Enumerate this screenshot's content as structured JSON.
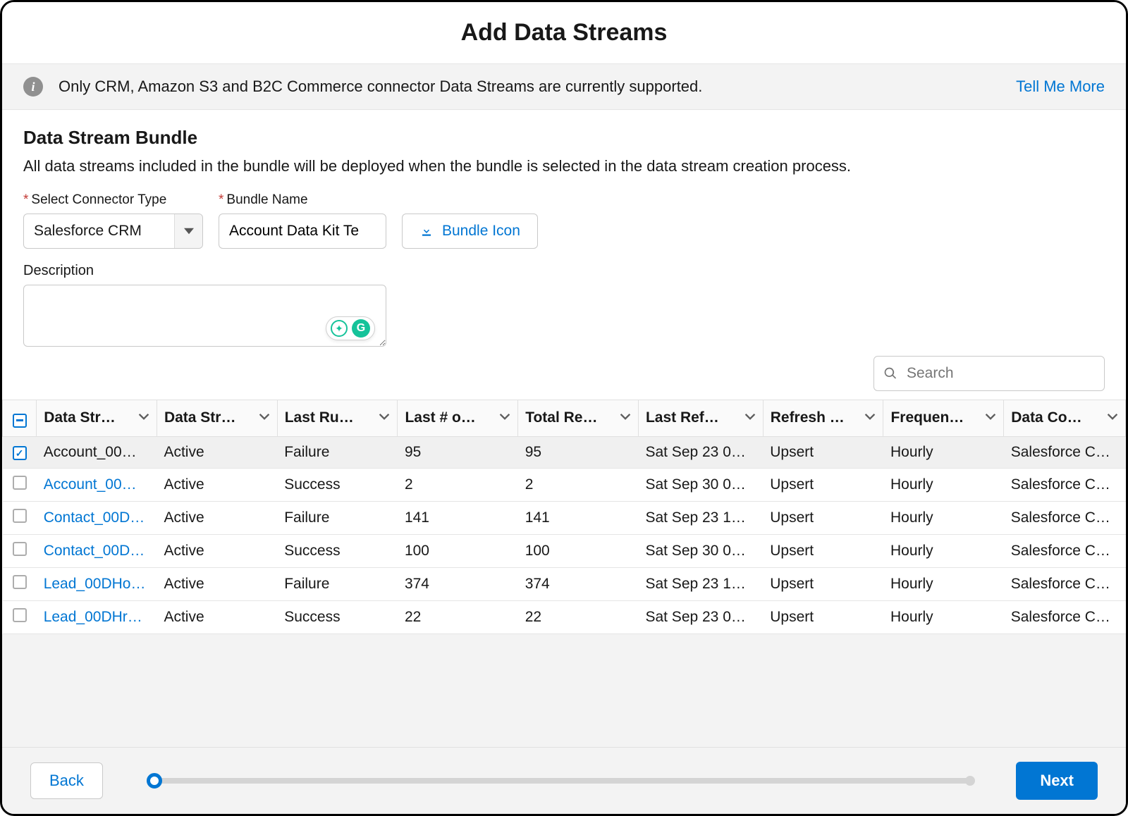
{
  "header": {
    "title": "Add Data Streams"
  },
  "infobar": {
    "message": "Only CRM, Amazon S3 and B2C Commerce connector Data Streams are currently supported.",
    "link": "Tell Me More"
  },
  "section": {
    "title": "Data Stream Bundle",
    "description": "All data streams included in the bundle will be deployed when the bundle is selected in the data stream creation process."
  },
  "form": {
    "connector_label": "Select Connector Type",
    "connector_value": "Salesforce CRM",
    "bundle_label": "Bundle Name",
    "bundle_value": "Account Data Kit Te",
    "bundle_icon_button": "Bundle Icon",
    "description_label": "Description",
    "description_value": ""
  },
  "search": {
    "placeholder": "Search"
  },
  "table": {
    "columns": [
      "Data Str…",
      "Data Str…",
      "Last Ru…",
      "Last # o…",
      "Total Re…",
      "Last Ref…",
      "Refresh …",
      "Frequen…",
      "Data Co…"
    ],
    "rows": [
      {
        "selected": true,
        "name": "Account_00…",
        "name_link": false,
        "c2": "Active",
        "c3": "Failure",
        "c4": "95",
        "c5": "95",
        "c6": "Sat Sep 23 0…",
        "c7": "Upsert",
        "c8": "Hourly",
        "c9": "Salesforce C…"
      },
      {
        "selected": false,
        "name": "Account_00…",
        "name_link": true,
        "c2": "Active",
        "c3": "Success",
        "c4": "2",
        "c5": "2",
        "c6": "Sat Sep 30 0…",
        "c7": "Upsert",
        "c8": "Hourly",
        "c9": "Salesforce C…"
      },
      {
        "selected": false,
        "name": "Contact_00D…",
        "name_link": true,
        "c2": "Active",
        "c3": "Failure",
        "c4": "141",
        "c5": "141",
        "c6": "Sat Sep 23 1…",
        "c7": "Upsert",
        "c8": "Hourly",
        "c9": "Salesforce C…"
      },
      {
        "selected": false,
        "name": "Contact_00D…",
        "name_link": true,
        "c2": "Active",
        "c3": "Success",
        "c4": "100",
        "c5": "100",
        "c6": "Sat Sep 30 0…",
        "c7": "Upsert",
        "c8": "Hourly",
        "c9": "Salesforce C…"
      },
      {
        "selected": false,
        "name": "Lead_00DHo…",
        "name_link": true,
        "c2": "Active",
        "c3": "Failure",
        "c4": "374",
        "c5": "374",
        "c6": "Sat Sep 23 1…",
        "c7": "Upsert",
        "c8": "Hourly",
        "c9": "Salesforce C…"
      },
      {
        "selected": false,
        "name": "Lead_00DHr…",
        "name_link": true,
        "c2": "Active",
        "c3": "Success",
        "c4": "22",
        "c5": "22",
        "c6": "Sat Sep 23 0…",
        "c7": "Upsert",
        "c8": "Hourly",
        "c9": "Salesforce C…"
      }
    ]
  },
  "footer": {
    "back": "Back",
    "next": "Next"
  },
  "colors": {
    "accent": "#0176d3"
  }
}
